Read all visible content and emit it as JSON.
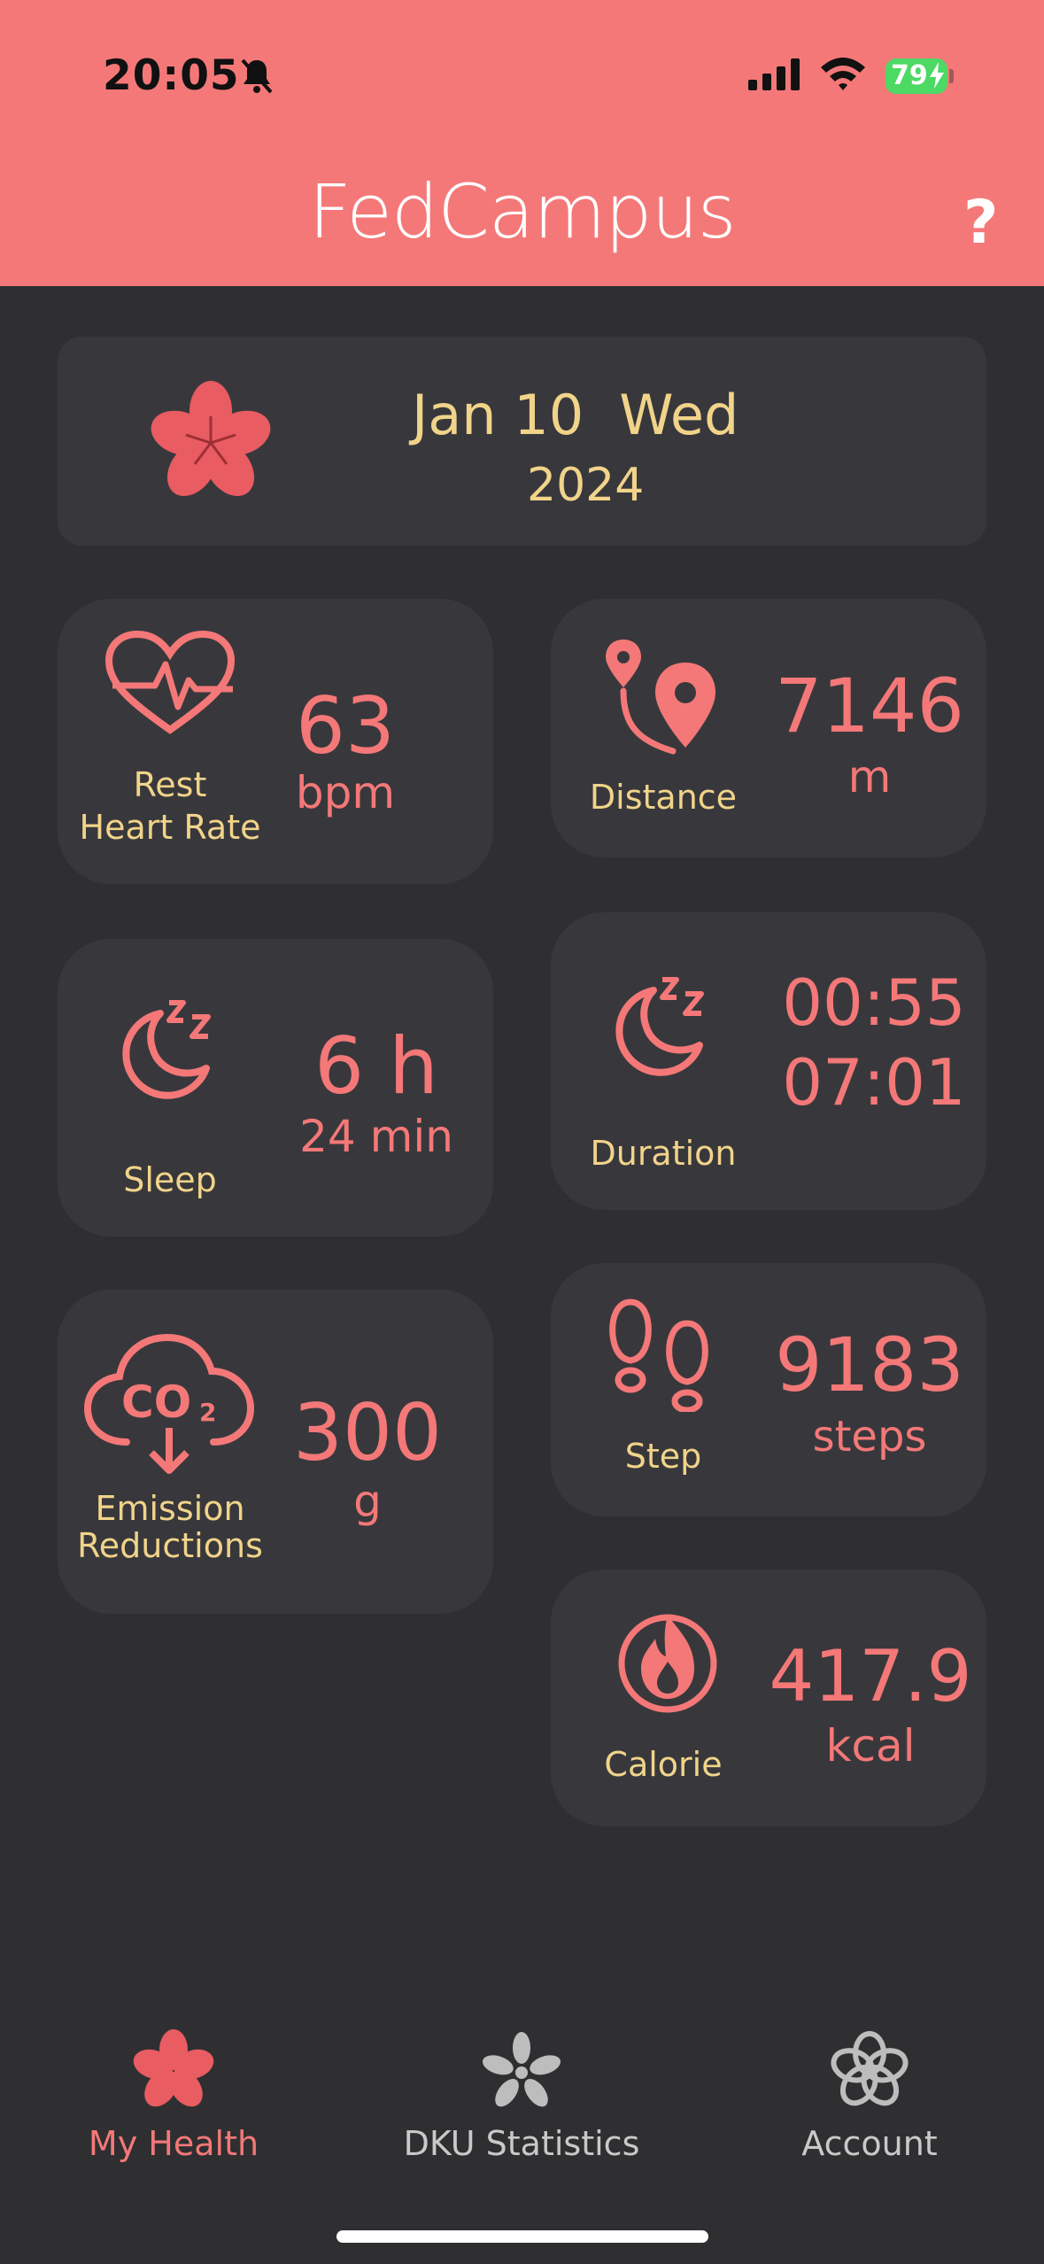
{
  "status": {
    "time": "20:05",
    "battery": "79"
  },
  "header": {
    "title": "FedCampus",
    "help": "?"
  },
  "date": {
    "month_day": "Jan 10",
    "weekday": "Wed",
    "year": "2024"
  },
  "cards": {
    "heart": {
      "label_line1": "Rest",
      "label_line2": "Heart Rate",
      "value": "63",
      "unit": "bpm"
    },
    "distance": {
      "label": "Distance",
      "value": "7146",
      "unit": "m"
    },
    "sleep": {
      "label": "Sleep",
      "value": "6 h",
      "unit": "24 min"
    },
    "duration": {
      "label": "Duration",
      "start": "00:55",
      "end": "07:01"
    },
    "emission": {
      "label_line1": "Emission",
      "label_line2": "Reductions",
      "value": "300",
      "unit": "g"
    },
    "step": {
      "label": "Step",
      "value": "9183",
      "unit": "steps"
    },
    "calorie": {
      "label": "Calorie",
      "value": "417.9",
      "unit": "kcal"
    }
  },
  "nav": {
    "items": [
      {
        "label": "My Health",
        "icon": "flower-icon",
        "active": true
      },
      {
        "label": "DKU Statistics",
        "icon": "statistics-icon",
        "active": false
      },
      {
        "label": "Account",
        "icon": "account-icon",
        "active": false
      }
    ]
  },
  "colors": {
    "accent": "#f47878",
    "label": "#f1d48a",
    "card": "#38383c",
    "background": "#2f2f31",
    "inactive_nav": "#c9c9c9"
  }
}
